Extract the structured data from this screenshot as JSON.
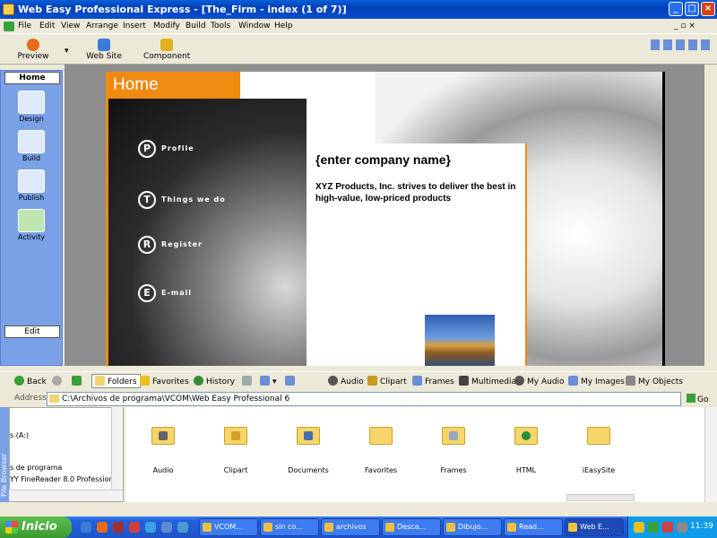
{
  "window": {
    "title": "Web Easy Professional Express - [The_Firm - index (1 of 7)]"
  },
  "menu": [
    "File",
    "Edit",
    "View",
    "Arrange",
    "Insert",
    "Modify",
    "Build",
    "Tools",
    "Window",
    "Help"
  ],
  "toolbar": {
    "preview": "Preview",
    "website": "Web Site",
    "component": "Component"
  },
  "left_panel": {
    "home": "Home",
    "buttons": [
      "Design",
      "Build",
      "Publish",
      "Activity"
    ],
    "edit": "Edit"
  },
  "page": {
    "home_label": "Home",
    "nav": [
      {
        "letter": "P",
        "label": "Profile"
      },
      {
        "letter": "T",
        "label": "Things we do"
      },
      {
        "letter": "R",
        "label": "Register"
      },
      {
        "letter": "E",
        "label": "E-mail"
      }
    ],
    "company_name": "{enter company name}",
    "tagline": "XYZ Products, Inc. strives to deliver the best in high-value, low-priced products"
  },
  "explorer": {
    "toolbar": [
      "Back",
      "Folders",
      "Favorites",
      "History",
      "Audio",
      "Clipart",
      "Frames",
      "Multimedia",
      "My Audio",
      "My Images",
      "My Objects"
    ],
    "address_label": "Address",
    "address_value": "C:\\Archivos de programa\\VCOM\\Web Easy Professional 6",
    "go_label": "Go",
    "side_tab": "File Browser",
    "tree": [
      "s (A:)",
      "s de programa",
      "YY FineReader 8.0 Profession"
    ],
    "folders": [
      "Audio",
      "Clipart",
      "Documents",
      "Favorites",
      "Frames",
      "HTML",
      "iEasySite"
    ]
  },
  "taskbar": {
    "start": "Inicio",
    "tasks": [
      "VCOM...",
      "sin co...",
      "archivos",
      "Desca...",
      "Dibujo...",
      "Read...",
      "Web E..."
    ],
    "clock": "11:39"
  },
  "colors": {
    "accent_orange": "#f08a10",
    "xp_blue": "#245edb",
    "panel_blue": "#7aa1e6"
  }
}
